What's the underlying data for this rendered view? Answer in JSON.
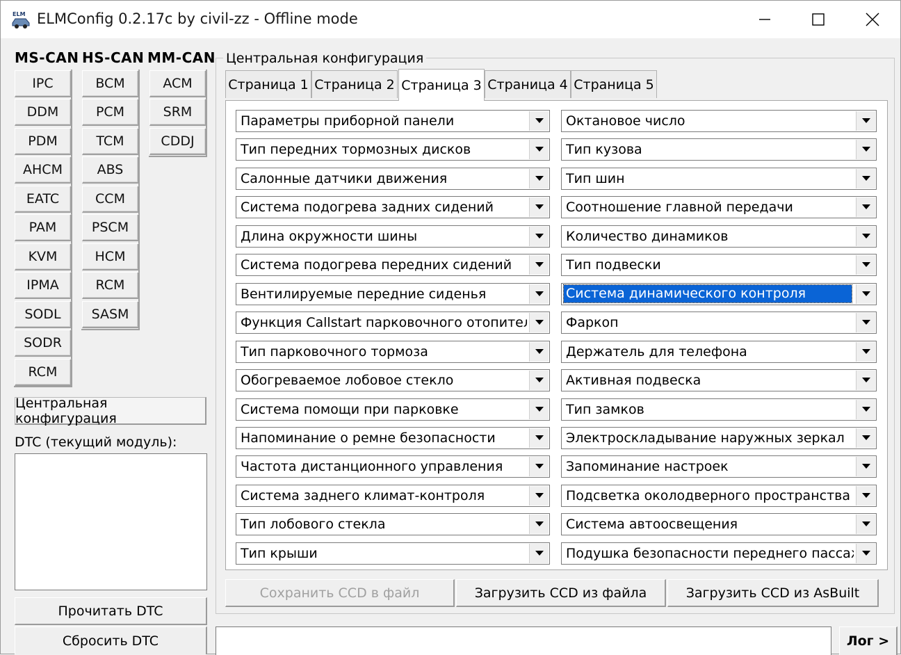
{
  "window": {
    "title": "ELMConfig 0.2.17c by civil-zz - Offline mode",
    "app_icon": "elm-car-icon",
    "controls": [
      "minimize-icon",
      "maximize-icon",
      "close-icon"
    ]
  },
  "can_groups": [
    {
      "label": "MS-CAN",
      "modules": [
        "IPC",
        "DDM",
        "PDM",
        "AHCM",
        "EATC",
        "PAM",
        "KVM",
        "IPMA",
        "SODL",
        "SODR",
        "RCM"
      ]
    },
    {
      "label": "HS-CAN",
      "modules": [
        "BCM",
        "PCM",
        "TCM",
        "ABS",
        "CCM",
        "PSCM",
        "HCM",
        "RCM",
        "SASM"
      ]
    },
    {
      "label": "MM-CAN",
      "modules": [
        "ACM",
        "SRM",
        "CDDJ"
      ]
    }
  ],
  "sidebar": {
    "central_config_button": "Центральная конфигурация",
    "dtc_label": "DTC (текущий модуль):",
    "read_dtc": "Прочитать DTC",
    "clear_dtc": "Сбросить DTC"
  },
  "central": {
    "group_title": "Центральная конфигурация",
    "tabs": [
      "Страница 1",
      "Страница 2",
      "Страница 3",
      "Страница 4",
      "Страница 5"
    ],
    "active_tab": "Страница 3",
    "left_fields": [
      "Параметры приборной панели",
      "Тип передних тормозных дисков",
      "Салонные датчики движения",
      "Система подогрева задних сидений",
      "Длина окружности шины",
      "Система подогрева передних сидений",
      "Вентилируемые передние сиденья",
      "Функция Callstart парковочного отопителя",
      "Тип парковочного тормоза",
      "Обогреваемое лобовое стекло",
      "Система помощи при парковке",
      "Напоминание о ремне безопасности",
      "Частота дистанционного управления",
      "Система заднего климат-контроля",
      "Тип лобового стекла",
      "Тип крыши"
    ],
    "right_fields": [
      "Октановое число",
      "Тип кузова",
      "Тип шин",
      "Соотношение главной передачи",
      "Количество динамиков",
      "Тип подвески",
      "Система динамического контроля",
      "Фаркоп",
      "Держатель для телефона",
      "Активная подвеска",
      "Тип замков",
      "Электроскладывание наружных зеркал",
      "Запоминание настроек",
      "Подсветка околодверного пространства",
      "Система автоосвещения",
      "Подушка безопасности переднего пассажира"
    ],
    "selected_field": "Система динамического контроля",
    "save_button": "Сохранить CCD в файл",
    "load_file_button": "Загрузить CCD из файла",
    "load_asbuilt_button": "Загрузить CCD из AsBuilt"
  },
  "footer": {
    "log_button": "Лог >",
    "status_text": ""
  },
  "colors": {
    "selection": "#0a64d6",
    "window_bg": "#f0f0f0",
    "disabled_text": "#a0a0a0"
  }
}
